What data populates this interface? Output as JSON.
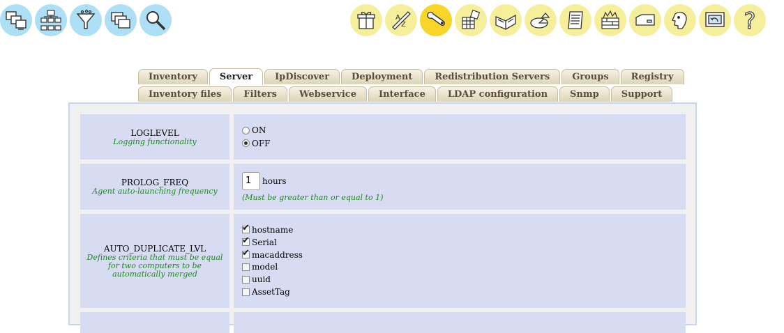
{
  "toolbar_left": [
    {
      "name": "computers-icon"
    },
    {
      "name": "network-icon"
    },
    {
      "name": "filter-icon"
    },
    {
      "name": "windows-icon"
    },
    {
      "name": "magnifier-icon"
    }
  ],
  "toolbar_right": [
    {
      "name": "gift-icon"
    },
    {
      "name": "az-dictionary-icon"
    },
    {
      "name": "wrench-icon",
      "active": true
    },
    {
      "name": "grid-config-icon"
    },
    {
      "name": "book-icon"
    },
    {
      "name": "pie-chart-icon"
    },
    {
      "name": "script-icon"
    },
    {
      "name": "firewall-icon"
    },
    {
      "name": "card-icon"
    },
    {
      "name": "face-icon"
    },
    {
      "name": "monitor-back-icon"
    },
    {
      "name": "help-icon"
    }
  ],
  "tabs_row1": [
    "Inventory",
    "Server",
    "IpDiscover",
    "Deployment",
    "Redistribution Servers",
    "Groups",
    "Registry"
  ],
  "tabs_row2": [
    "Inventory files",
    "Filters",
    "Webservice",
    "Interface",
    "LDAP configuration",
    "Snmp",
    "Support"
  ],
  "active_tab": "Server",
  "settings": {
    "loglevel": {
      "name": "LOGLEVEL",
      "desc": "Logging functionality",
      "on": "ON",
      "off": "OFF",
      "selected": "OFF"
    },
    "prolog_freq": {
      "name": "PROLOG_FREQ",
      "desc": "Agent auto-launching frequency",
      "value": "1",
      "unit": "hours",
      "hint": "(Must be greater than or equal to 1)"
    },
    "auto_duplicate": {
      "name": "AUTO_DUPLICATE_LVL",
      "desc": [
        "Defines criteria that must be equal",
        "for two computers to be",
        "automatically merged"
      ],
      "options": [
        {
          "label": "hostname",
          "checked": true
        },
        {
          "label": "Serial",
          "checked": true
        },
        {
          "label": "macaddress",
          "checked": true
        },
        {
          "label": "model",
          "checked": false
        },
        {
          "label": "uuid",
          "checked": false
        },
        {
          "label": "AssetTag",
          "checked": false
        }
      ]
    }
  },
  "colors": {
    "left_icons": "#aee0f5",
    "right_icons": "#f5ef9c",
    "active_icon": "#f7d629",
    "cell_bg": "#d8dcf3",
    "desc_green": "#1a8a1a"
  }
}
